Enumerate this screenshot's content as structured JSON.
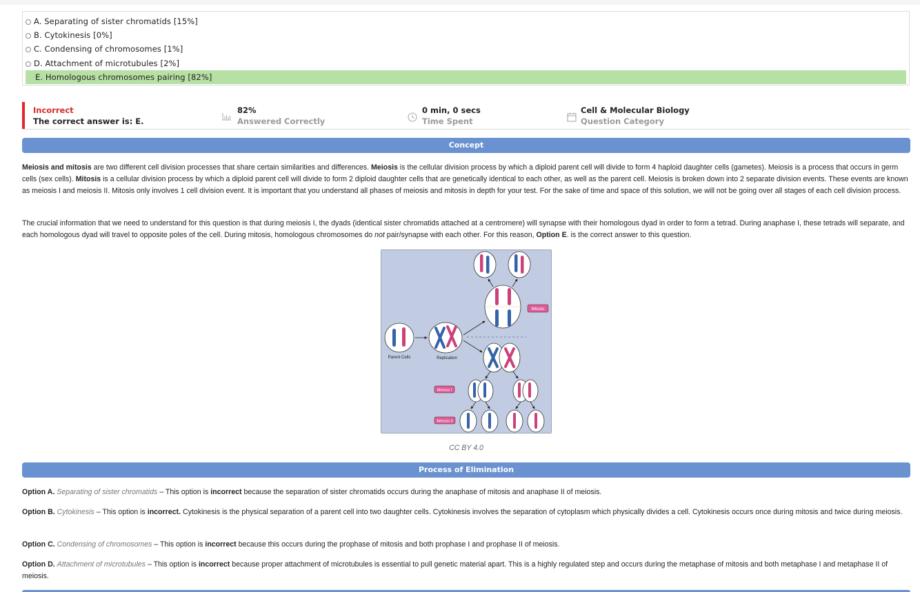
{
  "options": [
    {
      "text": "A. Separating of sister chromatids [15%]",
      "correct": false
    },
    {
      "text": "B. Cytokinesis [0%]",
      "correct": false
    },
    {
      "text": "C. Condensing of chromosomes [1%]",
      "correct": false
    },
    {
      "text": "D. Attachment of microtubules [2%]",
      "correct": false
    },
    {
      "text": "E. Homologous chromosomes pairing [82%]",
      "correct": true
    }
  ],
  "result": {
    "status": "Incorrect",
    "correct_answer": "The correct answer is: E."
  },
  "stats": {
    "percent": {
      "value": "82%",
      "label": "Answered Correctly",
      "icon": "bar-chart-icon"
    },
    "time": {
      "value": "0 min, 0 secs",
      "label": "Time Spent",
      "icon": "clock-icon"
    },
    "category": {
      "value": "Cell & Molecular Biology",
      "label": "Question Category",
      "icon": "calendar-icon"
    }
  },
  "colors": {
    "accent": "#6b92d0",
    "correct_bg": "#b7e0a4",
    "incorrect_red": "#e2262a"
  },
  "concept": {
    "title": "Concept",
    "p1": {
      "s1": "Meiosis and mitosis",
      "s2": " are two different cell division processes that share certain similarities and differences. ",
      "s3": "Meiosis",
      "s4": " is the cellular division process by which a diploid parent cell will divide to form 4 haploid daughter cells (gametes). Meiosis is a process that occurs in germ cells (sex cells). ",
      "s5": "Mitosis",
      "s6": " is a cellular division process by which a diploid parent cell will divide to form 2 diploid daughter cells that are genetically identical to each other, as well as the parent cell. Meiosis is broken down into 2 separate division events. These events are known as meiosis I and meiosis II. Mitosis only involves 1 cell division event. It is important that you understand all phases of meiosis and mitosis in depth for your test. For the sake of time and space of this solution, we will not be going over all stages of each cell division process."
    },
    "p2": {
      "s1": "The crucial information that we need to understand for this question is that during meiosis I, the dyads (identical sister chromatids attached at a centromere) will synapse with their homologous dyad in order to form a tetrad. During anaphase I, these tetrads will separate, and each homologous dyad will travel to opposite poles of the cell. During mitosis, homologous chromosomes do ",
      "s2": "not",
      "s3": " pair/synapse with each other. For this reason, ",
      "s4": "Option E",
      "s5": ". is the correct answer to this question."
    },
    "figure": {
      "labels": {
        "parent": "Parent Cells",
        "replication": "Replication",
        "mitosis": "Mitosis",
        "meiosis1": "Meiosis I",
        "meiosis2": "Meiosis II"
      },
      "caption": "CC BY 4.0"
    }
  },
  "elimination": {
    "title": "Process of Elimination",
    "a": {
      "label": "Option A.",
      "name": "Separating of sister chromatids",
      "t1": " – This option is ",
      "t2": "incorrect",
      "t3": " because the separation of sister chromatids occurs during the anaphase of mitosis and anaphase II of meiosis."
    },
    "b": {
      "label": "Option B.",
      "name": "Cytokinesis",
      "t1": " – This option is ",
      "t2": "incorrect.",
      "t3": "  Cytokinesis is the physical separation of a parent cell into two daughter cells. Cytokinesis involves the separation of cytoplasm which physically divides a cell. Cytokinesis occurs once during mitosis and twice during meiosis."
    },
    "c": {
      "label": "Option C.",
      "name": "Condensing of chromosomes",
      "t1": " – This option is ",
      "t2": "incorrect",
      "t3": " because this occurs during the prophase of mitosis and both prophase I and prophase II of meiosis."
    },
    "d": {
      "label": "Option D.",
      "name": "Attachment of microtubules",
      "t1": " – This option is ",
      "t2": "incorrect",
      "t3": " because proper attachment of microtubules is essential to pull genetic material apart. This is a highly regulated step and occurs during the metaphase of mitosis and both metaphase I and metaphase II of meiosis."
    }
  }
}
